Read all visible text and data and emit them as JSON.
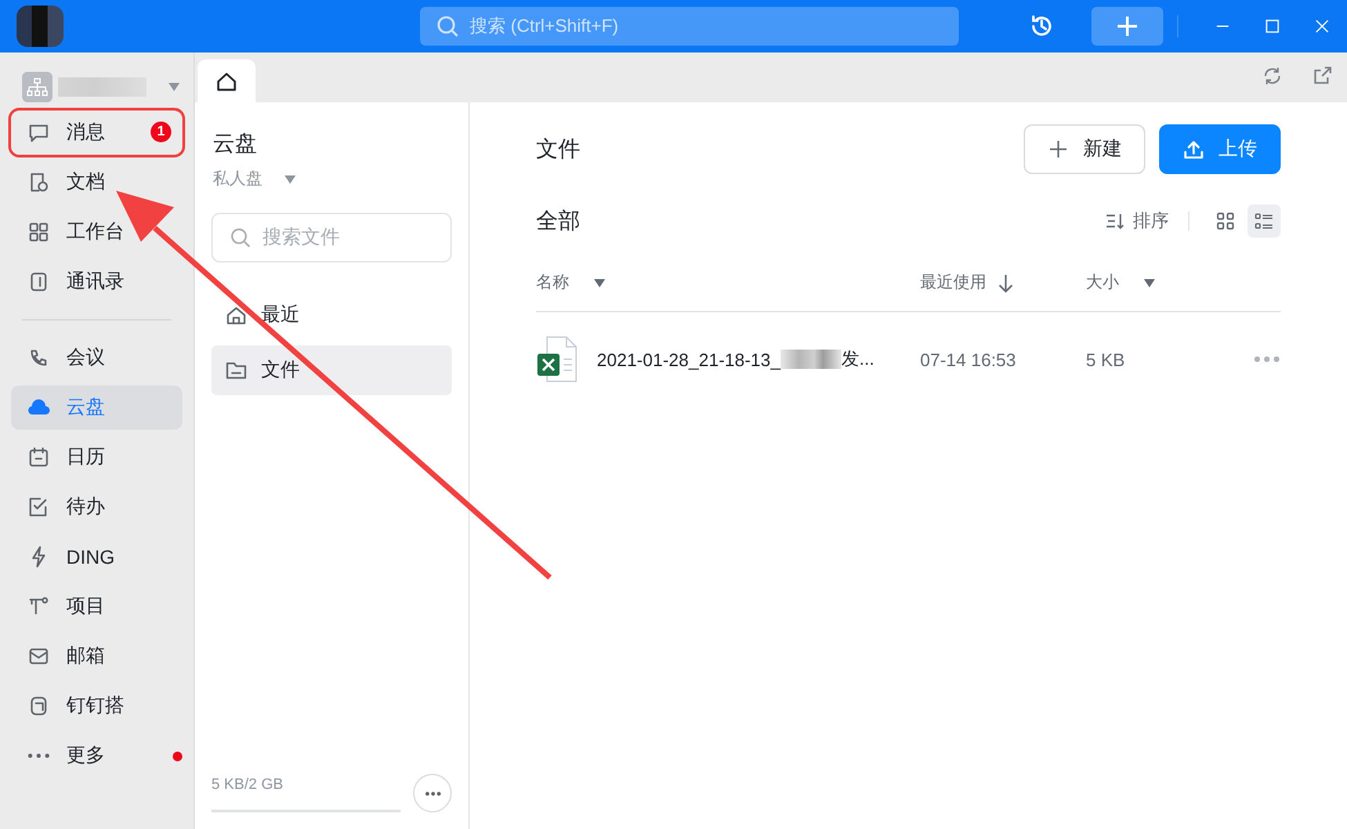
{
  "titlebar": {
    "search_placeholder": "搜索 (Ctrl+Shift+F)"
  },
  "sidebar": {
    "sections": [
      [
        {
          "label": "消息",
          "selected": false,
          "highlighted": true,
          "badge": "1"
        },
        {
          "label": "文档",
          "selected": false,
          "highlighted": false
        },
        {
          "label": "工作台",
          "selected": false,
          "highlighted": false
        },
        {
          "label": "通讯录",
          "selected": false,
          "highlighted": false
        }
      ],
      [
        {
          "label": "会议",
          "selected": false,
          "highlighted": false
        },
        {
          "label": "云盘",
          "selected": true,
          "highlighted": false
        },
        {
          "label": "日历",
          "selected": false,
          "highlighted": false
        },
        {
          "label": "待办",
          "selected": false,
          "highlighted": false
        },
        {
          "label": "DING",
          "selected": false,
          "highlighted": false
        },
        {
          "label": "项目",
          "selected": false,
          "highlighted": false
        },
        {
          "label": "邮箱",
          "selected": false,
          "highlighted": false
        },
        {
          "label": "钉钉搭",
          "selected": false,
          "highlighted": false
        },
        {
          "label": "更多",
          "selected": false,
          "highlighted": false,
          "dot": true
        }
      ]
    ]
  },
  "tabs": [
    {
      "kind": "home",
      "selected": true
    }
  ],
  "drive": {
    "title": "云盘",
    "scope": "私人盘",
    "search_placeholder": "搜索文件",
    "nav": [
      {
        "label": "最近",
        "selected": false
      },
      {
        "label": "文件",
        "selected": true
      }
    ],
    "storage": {
      "text": "5 KB/2 GB"
    }
  },
  "main": {
    "title": "文件",
    "buttons": [
      {
        "label": "新建",
        "kind": "secondary"
      },
      {
        "label": "上传",
        "kind": "primary"
      }
    ],
    "section": "全部",
    "sort_label": "排序",
    "views": [
      {
        "kind": "grid",
        "selected": false
      },
      {
        "kind": "list",
        "selected": true
      }
    ],
    "table": {
      "columns": [
        {
          "label": "名称",
          "kind": "dropdown"
        },
        {
          "label": "最近使用",
          "kind": "sorted"
        },
        {
          "label": "大小",
          "kind": "dropdown"
        }
      ],
      "rows": [
        {
          "name_start": "2021-01-28_21-18-13_",
          "name_end": "发...",
          "used": "07-14 16:53",
          "size": "5 KB"
        }
      ]
    }
  },
  "annotation": {
    "arrow": true
  }
}
